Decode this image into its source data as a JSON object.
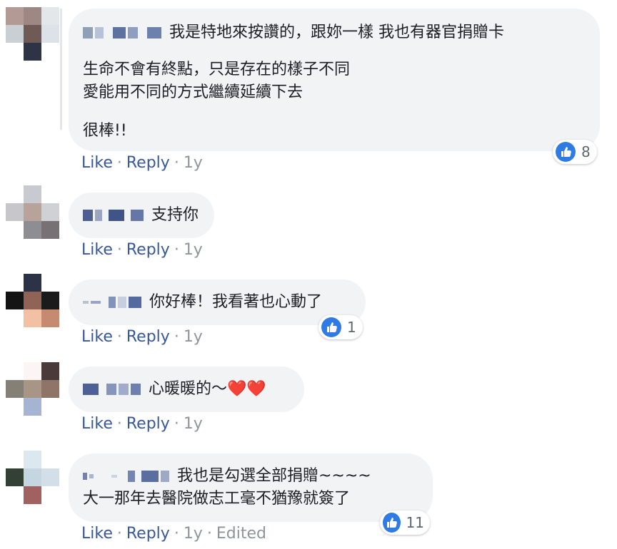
{
  "comments": [
    {
      "lines": [
        "我是特地來按讚的，跟妳一樣 我也有器官捐贈卡",
        "生命不會有終點，只是存在的樣子不同",
        "愛能用不同的方式繼續延續下去",
        "很棒!!"
      ],
      "like": "Like",
      "reply": "Reply",
      "time": "1y",
      "reactions": "8"
    },
    {
      "lines": [
        "支持你"
      ],
      "like": "Like",
      "reply": "Reply",
      "time": "1y"
    },
    {
      "lines": [
        "你好棒！我看著也心動了"
      ],
      "like": "Like",
      "reply": "Reply",
      "time": "1y",
      "reactions": "1"
    },
    {
      "lines": [
        "心暖暖的～❤️❤️"
      ],
      "like": "Like",
      "reply": "Reply",
      "time": "1y"
    },
    {
      "lines": [
        "我也是勾選全部捐贈~~~~",
        "大一那年去醫院做志工毫不猶豫就簽了"
      ],
      "like": "Like",
      "reply": "Reply",
      "time": "1y",
      "edited": "Edited",
      "reactions": "11"
    }
  ],
  "separator": "·",
  "colors": {
    "link": "#385898",
    "meta": "#90949c",
    "bubble": "#f2f3f5",
    "like_blue": "#2e7be5"
  },
  "icons": {
    "reaction": "thumbs-up-icon"
  }
}
